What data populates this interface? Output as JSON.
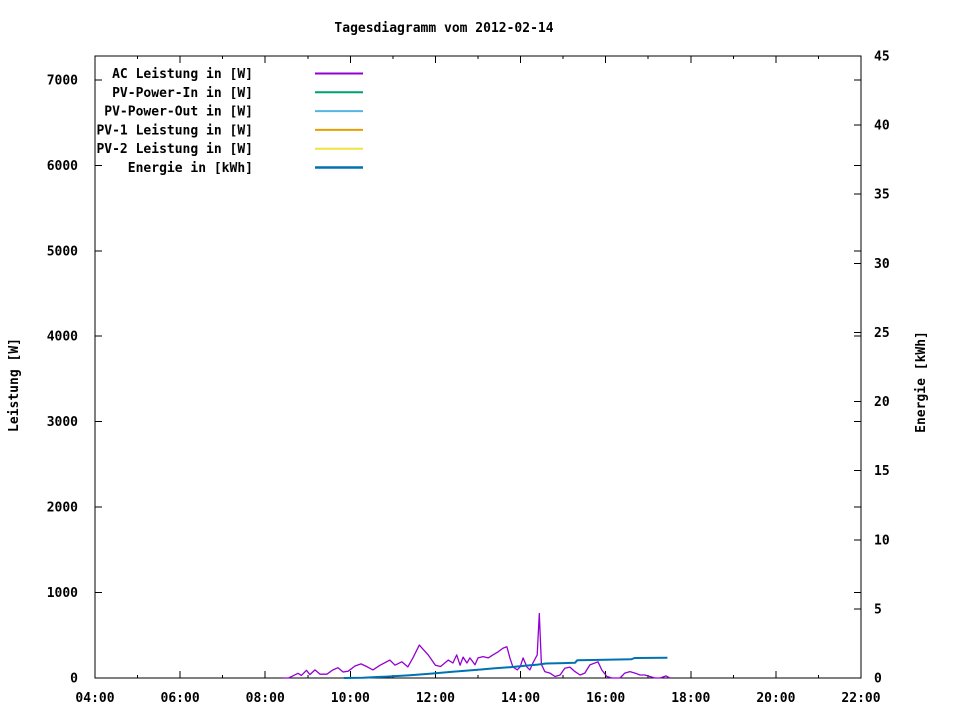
{
  "chart_data": {
    "type": "line",
    "title": "Tagesdiagramm vom 2012-02-14",
    "grid": false,
    "legend_position": "top-left-inside",
    "background_color": "#ffffff",
    "axis_color": "#000000",
    "x_axis": {
      "label": "",
      "range": [
        4,
        22
      ],
      "tick_hours": [
        4,
        6,
        8,
        10,
        12,
        14,
        16,
        18,
        20,
        22
      ],
      "tick_labels": [
        "04:00",
        "06:00",
        "08:00",
        "10:00",
        "12:00",
        "14:00",
        "16:00",
        "18:00",
        "20:00",
        "22:00"
      ],
      "minor_step_hours": 1
    },
    "y_axis": {
      "label": "Leistung [W]",
      "range": [
        0,
        7280
      ],
      "ticks": [
        0,
        1000,
        2000,
        3000,
        4000,
        5000,
        6000,
        7000
      ]
    },
    "y2_axis": {
      "label": "Energie [kWh]",
      "range": [
        0,
        45
      ],
      "ticks": [
        0,
        5,
        10,
        15,
        20,
        25,
        30,
        35,
        40,
        45
      ]
    },
    "series": [
      {
        "id": "ac-leistung",
        "name": "AC Leistung in [W]",
        "color": "#9400d3",
        "axis": "y",
        "line_width": 1.3,
        "points": [
          [
            8.42,
            0
          ],
          [
            8.55,
            0
          ],
          [
            8.63,
            20
          ],
          [
            8.77,
            55
          ],
          [
            8.85,
            30
          ],
          [
            8.97,
            90
          ],
          [
            9.05,
            40
          ],
          [
            9.17,
            95
          ],
          [
            9.29,
            45
          ],
          [
            9.45,
            45
          ],
          [
            9.59,
            95
          ],
          [
            9.71,
            120
          ],
          [
            9.83,
            70
          ],
          [
            9.95,
            80
          ],
          [
            10.11,
            140
          ],
          [
            10.25,
            165
          ],
          [
            10.4,
            130
          ],
          [
            10.53,
            95
          ],
          [
            10.7,
            150
          ],
          [
            10.93,
            210
          ],
          [
            11.05,
            150
          ],
          [
            11.21,
            190
          ],
          [
            11.35,
            130
          ],
          [
            11.47,
            235
          ],
          [
            11.62,
            385
          ],
          [
            11.83,
            270
          ],
          [
            12.0,
            150
          ],
          [
            12.12,
            135
          ],
          [
            12.3,
            210
          ],
          [
            12.41,
            175
          ],
          [
            12.5,
            270
          ],
          [
            12.58,
            150
          ],
          [
            12.65,
            245
          ],
          [
            12.74,
            175
          ],
          [
            12.81,
            235
          ],
          [
            12.93,
            155
          ],
          [
            13.0,
            235
          ],
          [
            13.12,
            250
          ],
          [
            13.24,
            235
          ],
          [
            13.35,
            270
          ],
          [
            13.47,
            305
          ],
          [
            13.59,
            350
          ],
          [
            13.68,
            365
          ],
          [
            13.75,
            235
          ],
          [
            13.82,
            130
          ],
          [
            13.92,
            95
          ],
          [
            13.99,
            130
          ],
          [
            14.06,
            235
          ],
          [
            14.15,
            130
          ],
          [
            14.22,
            95
          ],
          [
            14.29,
            175
          ],
          [
            14.39,
            270
          ],
          [
            14.44,
            755
          ],
          [
            14.49,
            160
          ],
          [
            14.53,
            118
          ],
          [
            14.57,
            75
          ],
          [
            14.69,
            57
          ],
          [
            14.81,
            17
          ],
          [
            14.93,
            35
          ],
          [
            15.04,
            115
          ],
          [
            15.16,
            128
          ],
          [
            15.28,
            75
          ],
          [
            15.4,
            35
          ],
          [
            15.51,
            57
          ],
          [
            15.63,
            153
          ],
          [
            15.82,
            190
          ],
          [
            15.91,
            94
          ],
          [
            16.03,
            17
          ],
          [
            16.15,
            0
          ],
          [
            16.34,
            0
          ],
          [
            16.45,
            57
          ],
          [
            16.57,
            75
          ],
          [
            16.69,
            57
          ],
          [
            16.81,
            35
          ],
          [
            16.92,
            35
          ],
          [
            17.04,
            17
          ],
          [
            17.16,
            0
          ],
          [
            17.28,
            0
          ],
          [
            17.42,
            25
          ],
          [
            17.51,
            0
          ]
        ]
      },
      {
        "id": "pv-power-in",
        "name": "PV-Power-In in [W]",
        "color": "#009e73",
        "axis": "y",
        "line_width": 1.3,
        "points": []
      },
      {
        "id": "pv-power-out",
        "name": "PV-Power-Out in [W]",
        "color": "#56b4e9",
        "axis": "y",
        "line_width": 1.3,
        "points": []
      },
      {
        "id": "pv1-leistung",
        "name": "PV-1 Leistung in [W]",
        "color": "#e69f00",
        "axis": "y",
        "line_width": 1.3,
        "points": []
      },
      {
        "id": "pv2-leistung",
        "name": "PV-2 Leistung in [W]",
        "color": "#f0e442",
        "axis": "y",
        "line_width": 1.3,
        "points": []
      },
      {
        "id": "energie",
        "name": "Energie in [kWh]",
        "color": "#0072b2",
        "axis": "y2",
        "line_width": 2,
        "points": [
          [
            9.85,
            0
          ],
          [
            10.3,
            0.02
          ],
          [
            10.85,
            0.1
          ],
          [
            11.4,
            0.2
          ],
          [
            11.9,
            0.32
          ],
          [
            12.4,
            0.45
          ],
          [
            12.7,
            0.52
          ],
          [
            13.1,
            0.62
          ],
          [
            13.4,
            0.7
          ],
          [
            13.75,
            0.78
          ],
          [
            14.1,
            0.88
          ],
          [
            14.4,
            0.97
          ],
          [
            14.6,
            1.05
          ],
          [
            15.0,
            1.08
          ],
          [
            15.28,
            1.1
          ],
          [
            15.33,
            1.28
          ],
          [
            16.0,
            1.32
          ],
          [
            16.6,
            1.35
          ],
          [
            16.68,
            1.45
          ],
          [
            17.45,
            1.47
          ]
        ]
      }
    ]
  }
}
